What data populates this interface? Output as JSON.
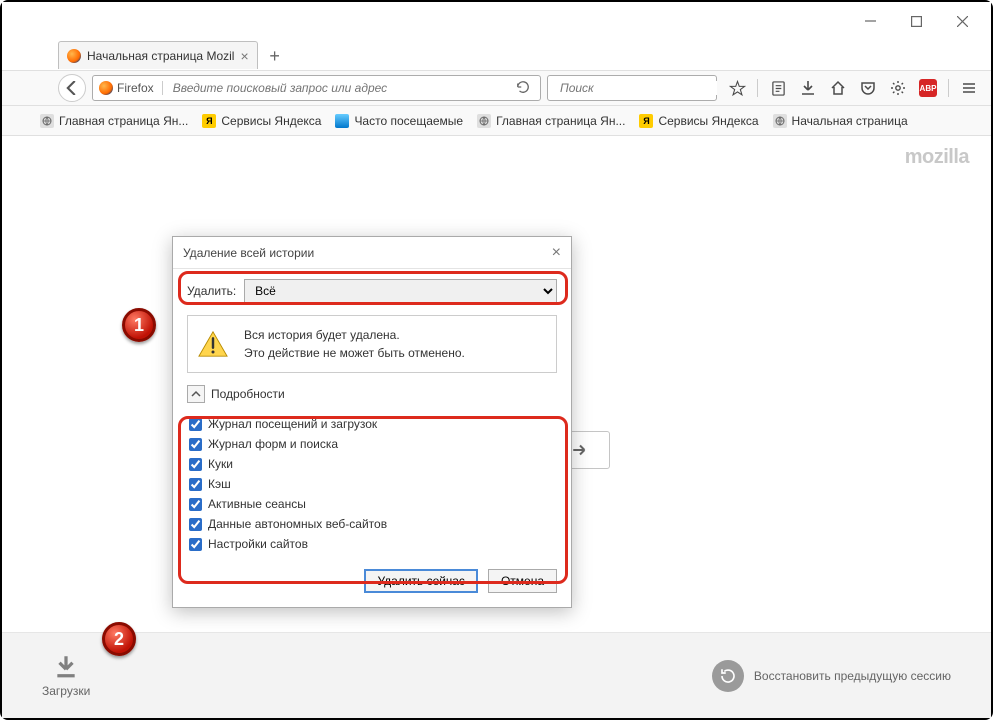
{
  "tab": {
    "title": "Начальная страница Mozil"
  },
  "nav": {
    "identity": "Firefox",
    "url_placeholder": "Введите поисковый запрос или адрес",
    "search_placeholder": "Поиск"
  },
  "bookmarks": [
    {
      "label": "Главная страница Ян...",
      "icon": "globe"
    },
    {
      "label": "Сервисы Яндекса",
      "icon": "yandex"
    },
    {
      "label": "Часто посещаемые",
      "icon": "moz"
    },
    {
      "label": "Главная страница Ян...",
      "icon": "globe"
    },
    {
      "label": "Сервисы Яндекса",
      "icon": "yandex"
    },
    {
      "label": "Начальная страница",
      "icon": "globe"
    }
  ],
  "page": {
    "brand": "mozilla",
    "downloads_label": "Загрузки",
    "restore_label": "Восстановить предыдущую сессию"
  },
  "dialog": {
    "title": "Удаление всей истории",
    "delete_label": "Удалить:",
    "delete_value": "Всё",
    "warn1": "Вся история будет удалена.",
    "warn2": "Это действие не может быть отменено.",
    "details_label": "Подробности",
    "items": [
      "Журнал посещений и загрузок",
      "Журнал форм и поиска",
      "Куки",
      "Кэш",
      "Активные сеансы",
      "Данные автономных веб-сайтов",
      "Настройки сайтов"
    ],
    "delete_now": "Удалить сейчас",
    "cancel": "Отмена"
  },
  "badges": {
    "one": "1",
    "two": "2"
  }
}
